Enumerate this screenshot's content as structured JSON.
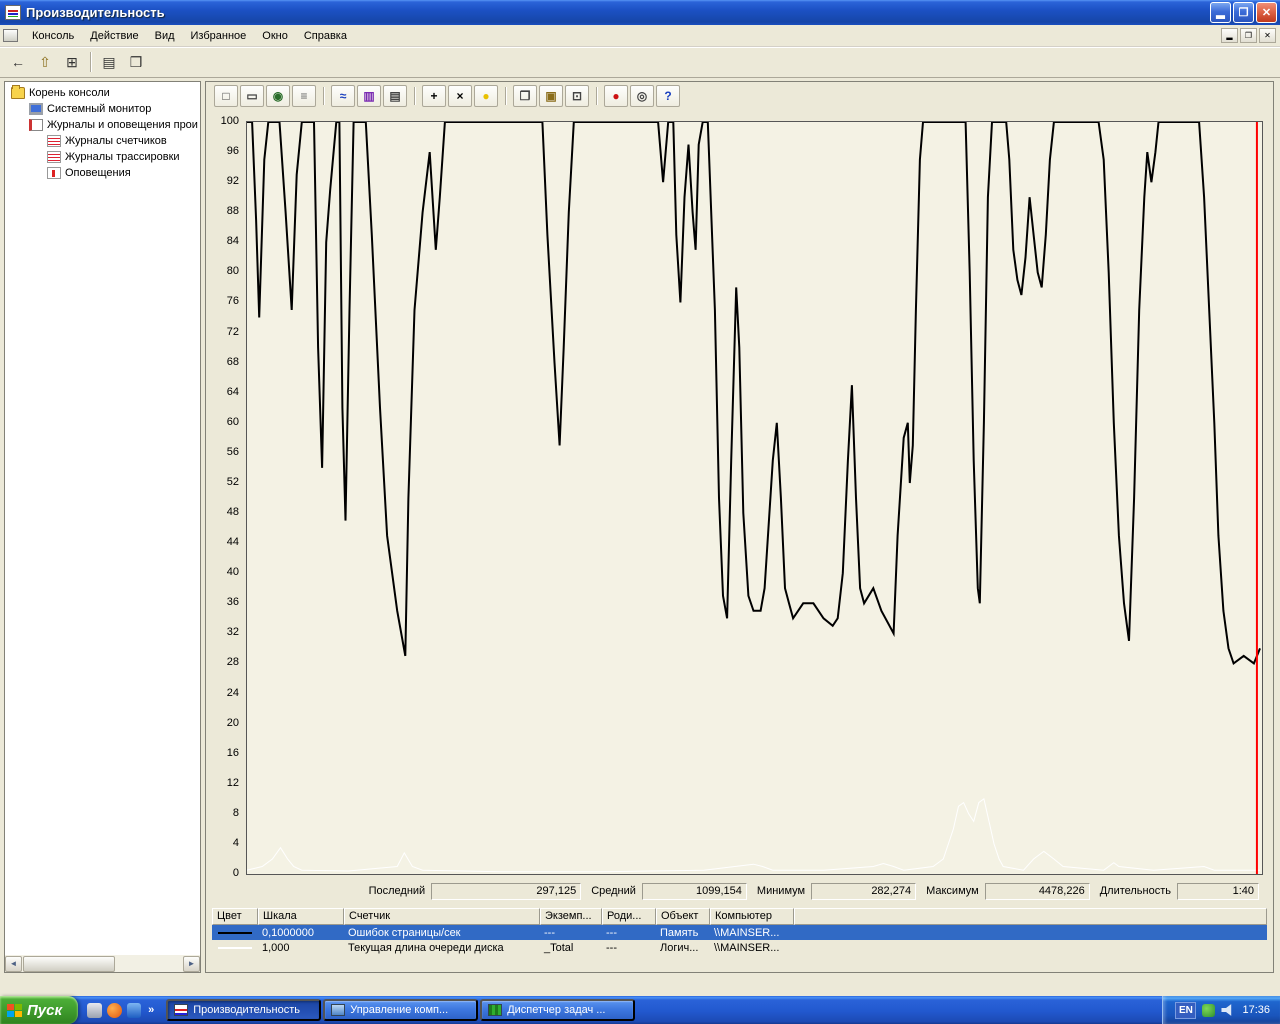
{
  "window": {
    "title": "Производительность",
    "controls": {
      "minimize": "▂",
      "restore": "❐",
      "close": "✕"
    }
  },
  "menubar": {
    "items": [
      "Консоль",
      "Действие",
      "Вид",
      "Избранное",
      "Окно",
      "Справка"
    ]
  },
  "main_toolbar": {
    "buttons": [
      {
        "name": "back-button",
        "glyph": "←",
        "color": "#333333"
      },
      {
        "name": "up-one-level-button",
        "glyph": "⇧",
        "color": "#8a6d1a"
      },
      {
        "name": "show-hide-console-tree-button",
        "glyph": "⊞",
        "color": "#333333"
      },
      {
        "name": "export-list-button",
        "glyph": "▤",
        "color": "#333333",
        "sep_before": true
      },
      {
        "name": "help-topics-button",
        "glyph": "❒",
        "color": "#333333"
      }
    ]
  },
  "tree": {
    "items": [
      {
        "id": "console-root",
        "label": "Корень консоли",
        "icon": "folder",
        "indent": 0
      },
      {
        "id": "system-monitor",
        "label": "Системный монитор",
        "icon": "monitor",
        "indent": 1
      },
      {
        "id": "logs-and-alerts",
        "label": "Журналы и оповещения прои",
        "icon": "logs",
        "indent": 1
      },
      {
        "id": "counter-logs",
        "label": "Журналы счетчиков",
        "icon": "redlog",
        "indent": 2
      },
      {
        "id": "trace-logs",
        "label": "Журналы трассировки",
        "icon": "redlog",
        "indent": 2
      },
      {
        "id": "alerts",
        "label": "Оповещения",
        "icon": "alert",
        "indent": 2
      }
    ]
  },
  "perfmon_toolbar": {
    "buttons": [
      {
        "name": "new-counter-set-button",
        "glyph": "□",
        "color": "#444444"
      },
      {
        "name": "clear-display-button",
        "glyph": "▭",
        "color": "#444444"
      },
      {
        "name": "view-current-activity-button",
        "glyph": "◉",
        "color": "#2a6d2a"
      },
      {
        "name": "view-log-data-button",
        "glyph": "≡",
        "color": "#666666"
      },
      {
        "name": "view-graph-button",
        "glyph": "≈",
        "color": "#1a3fbf",
        "sep_before": true
      },
      {
        "name": "view-histogram-button",
        "glyph": "▥",
        "color": "#7a2bb2"
      },
      {
        "name": "view-report-button",
        "glyph": "▤",
        "color": "#444444"
      },
      {
        "name": "add-counter-button",
        "glyph": "+",
        "color": "#000000",
        "sep_before": true
      },
      {
        "name": "delete-counter-button",
        "glyph": "×",
        "color": "#000000"
      },
      {
        "name": "highlight-button",
        "glyph": "●",
        "color": "#e8c000"
      },
      {
        "name": "copy-properties-button",
        "glyph": "❐",
        "color": "#444444",
        "sep_before": true
      },
      {
        "name": "paste-counter-list-button",
        "glyph": "▣",
        "color": "#8a6d1a"
      },
      {
        "name": "properties-button",
        "glyph": "⊡",
        "color": "#444444"
      },
      {
        "name": "freeze-display-button",
        "glyph": "●",
        "color": "#cc1111",
        "sep_before": true
      },
      {
        "name": "update-data-button",
        "glyph": "◎",
        "color": "#444444"
      },
      {
        "name": "help-button",
        "glyph": "?",
        "color": "#1a3fbf"
      }
    ]
  },
  "stats": [
    {
      "label": "Последний",
      "value": "297,125"
    },
    {
      "label": "Средний",
      "value": "1099,154"
    },
    {
      "label": "Минимум",
      "value": "282,274"
    },
    {
      "label": "Максимум",
      "value": "4478,226"
    },
    {
      "label": "Длительность",
      "value": "1:40"
    }
  ],
  "legend": {
    "headers": [
      "Цвет",
      "Шкала",
      "Счетчик",
      "Экземп...",
      "Роди...",
      "Объект",
      "Компьютер"
    ],
    "rows": [
      {
        "selected": true,
        "color": "#000000",
        "scale": "0,1000000",
        "counter": "Ошибок страницы/сек",
        "instance": "---",
        "parent": "---",
        "object": "Память",
        "computer": "\\\\MAINSER..."
      },
      {
        "selected": false,
        "color": "#ffffff",
        "scale": "1,000",
        "counter": "Текущая длина очереди диска",
        "instance": "_Total",
        "parent": "---",
        "object": "Логич...",
        "computer": "\\\\MAINSER..."
      }
    ]
  },
  "taskbar": {
    "start_label": "Пуск",
    "quick_launch_chevron": "»",
    "tasks": [
      {
        "id": "performance",
        "label": "Производительность",
        "icon": "perfmon",
        "active": true
      },
      {
        "id": "computer-management",
        "label": "Управление комп...",
        "icon": "computer",
        "active": false
      },
      {
        "id": "task-manager",
        "label": "Диспетчер задач ...",
        "icon": "taskman",
        "active": false
      }
    ],
    "tray": {
      "language_indicator": "EN",
      "clock": "17:36"
    }
  },
  "chart_data": {
    "type": "line",
    "title": "",
    "xlabel": "",
    "ylabel": "",
    "ylim": [
      0,
      100
    ],
    "grid": false,
    "legend_position": "bottom-table",
    "y_ticks": [
      100,
      96,
      92,
      88,
      84,
      80,
      76,
      72,
      68,
      64,
      60,
      56,
      52,
      48,
      44,
      40,
      36,
      32,
      28,
      24,
      20,
      16,
      12,
      8,
      4,
      0
    ],
    "duration": "1:40",
    "timeline": {
      "x_pct": 99.5,
      "color": "#ff0000"
    },
    "stats": {
      "last": "297,125",
      "average": "1099,154",
      "minimum": "282,274",
      "maximum": "4478,226",
      "duration": "1:40"
    },
    "series": [
      {
        "name": "Ошибок страницы/сек (шкала 0,1)",
        "color": "#000000",
        "width": 2,
        "points": [
          [
            0,
            100
          ],
          [
            0.5,
            100
          ],
          [
            0.9,
            87
          ],
          [
            1.2,
            74
          ],
          [
            1.7,
            95
          ],
          [
            2.1,
            100
          ],
          [
            3.2,
            100
          ],
          [
            3.8,
            88
          ],
          [
            4.4,
            75
          ],
          [
            4.9,
            93
          ],
          [
            5.4,
            100
          ],
          [
            6.6,
            100
          ],
          [
            7.0,
            70
          ],
          [
            7.4,
            54
          ],
          [
            7.8,
            84
          ],
          [
            8.2,
            91
          ],
          [
            8.8,
            100
          ],
          [
            9.1,
            100
          ],
          [
            9.4,
            62
          ],
          [
            9.7,
            47
          ],
          [
            10.1,
            75
          ],
          [
            10.5,
            100
          ],
          [
            11.7,
            100
          ],
          [
            12.3,
            85
          ],
          [
            13.1,
            62
          ],
          [
            13.8,
            45
          ],
          [
            14.8,
            35
          ],
          [
            15.6,
            29
          ],
          [
            15.9,
            50
          ],
          [
            16.5,
            75
          ],
          [
            17.3,
            88
          ],
          [
            18.0,
            96
          ],
          [
            18.6,
            83
          ],
          [
            19.0,
            90
          ],
          [
            19.5,
            100
          ],
          [
            29.1,
            100
          ],
          [
            29.6,
            85
          ],
          [
            30.3,
            68
          ],
          [
            30.8,
            57
          ],
          [
            31.2,
            70
          ],
          [
            31.7,
            88
          ],
          [
            32.2,
            100
          ],
          [
            40.5,
            100
          ],
          [
            41.0,
            92
          ],
          [
            41.5,
            100
          ],
          [
            42.0,
            100
          ],
          [
            42.3,
            85
          ],
          [
            42.7,
            76
          ],
          [
            43.1,
            90
          ],
          [
            43.5,
            97
          ],
          [
            43.9,
            88
          ],
          [
            44.2,
            83
          ],
          [
            44.5,
            97
          ],
          [
            44.9,
            100
          ],
          [
            45.4,
            100
          ],
          [
            46.1,
            75
          ],
          [
            46.5,
            50
          ],
          [
            46.9,
            37
          ],
          [
            47.3,
            34
          ],
          [
            47.7,
            55
          ],
          [
            48.2,
            78
          ],
          [
            48.5,
            70
          ],
          [
            48.9,
            48
          ],
          [
            49.4,
            37
          ],
          [
            49.9,
            35
          ],
          [
            50.6,
            35
          ],
          [
            51.0,
            38
          ],
          [
            51.8,
            55
          ],
          [
            52.2,
            60
          ],
          [
            52.6,
            50
          ],
          [
            53.0,
            38
          ],
          [
            53.4,
            36
          ],
          [
            53.8,
            34
          ],
          [
            54.8,
            36
          ],
          [
            55.8,
            36
          ],
          [
            56.8,
            34
          ],
          [
            57.7,
            33
          ],
          [
            58.2,
            34
          ],
          [
            58.7,
            40
          ],
          [
            59.2,
            55
          ],
          [
            59.6,
            65
          ],
          [
            60.0,
            50
          ],
          [
            60.4,
            38
          ],
          [
            60.8,
            36
          ],
          [
            61.7,
            38
          ],
          [
            62.5,
            35
          ],
          [
            63.3,
            33
          ],
          [
            63.7,
            32
          ],
          [
            64.1,
            45
          ],
          [
            64.7,
            58
          ],
          [
            65.1,
            60
          ],
          [
            65.3,
            52
          ],
          [
            65.6,
            57
          ],
          [
            65.9,
            75
          ],
          [
            66.3,
            95
          ],
          [
            66.6,
            100
          ],
          [
            70.8,
            100
          ],
          [
            71.2,
            80
          ],
          [
            71.6,
            55
          ],
          [
            72.0,
            38
          ],
          [
            72.2,
            36
          ],
          [
            72.6,
            60
          ],
          [
            73.0,
            90
          ],
          [
            73.4,
            100
          ],
          [
            74.8,
            100
          ],
          [
            75.1,
            95
          ],
          [
            75.5,
            83
          ],
          [
            75.9,
            79
          ],
          [
            76.3,
            77
          ],
          [
            76.7,
            82
          ],
          [
            77.1,
            90
          ],
          [
            77.5,
            85
          ],
          [
            77.9,
            80
          ],
          [
            78.3,
            78
          ],
          [
            78.7,
            85
          ],
          [
            79.1,
            95
          ],
          [
            79.5,
            100
          ],
          [
            83.9,
            100
          ],
          [
            84.4,
            95
          ],
          [
            84.9,
            80
          ],
          [
            85.4,
            60
          ],
          [
            85.9,
            45
          ],
          [
            86.4,
            36
          ],
          [
            86.9,
            31
          ],
          [
            87.4,
            50
          ],
          [
            87.9,
            75
          ],
          [
            88.4,
            90
          ],
          [
            88.7,
            96
          ],
          [
            89.1,
            92
          ],
          [
            89.5,
            96
          ],
          [
            89.8,
            100
          ],
          [
            90.3,
            100
          ],
          [
            93.8,
            100
          ],
          [
            94.3,
            90
          ],
          [
            94.8,
            75
          ],
          [
            95.3,
            60
          ],
          [
            95.7,
            45
          ],
          [
            96.2,
            35
          ],
          [
            96.7,
            30
          ],
          [
            97.2,
            28
          ],
          [
            98.2,
            29
          ],
          [
            99.2,
            28
          ],
          [
            99.8,
            30
          ]
        ]
      },
      {
        "name": "Текущая длина очереди диска (_Total)",
        "color": "#ffffff",
        "width": 1,
        "points": [
          [
            0,
            0.5
          ],
          [
            1.5,
            1
          ],
          [
            2.5,
            2
          ],
          [
            3.3,
            3.5
          ],
          [
            4.0,
            2
          ],
          [
            4.6,
            1
          ],
          [
            5.4,
            0.5
          ],
          [
            10,
            0.4
          ],
          [
            14.8,
            1
          ],
          [
            15.5,
            2.8
          ],
          [
            16.3,
            1
          ],
          [
            17.3,
            0.5
          ],
          [
            25,
            0.3
          ],
          [
            35,
            0.3
          ],
          [
            45,
            0.5
          ],
          [
            49.9,
            1.3
          ],
          [
            50.8,
            1
          ],
          [
            51.8,
            0.5
          ],
          [
            56.8,
            0.5
          ],
          [
            61.7,
            1
          ],
          [
            62.7,
            1.4
          ],
          [
            63.7,
            1
          ],
          [
            64.7,
            0.5
          ],
          [
            67.6,
            1
          ],
          [
            68.6,
            2
          ],
          [
            69.6,
            6
          ],
          [
            70.1,
            9
          ],
          [
            70.6,
            9.5
          ],
          [
            71.1,
            8
          ],
          [
            71.6,
            7
          ],
          [
            72.1,
            9.5
          ],
          [
            72.6,
            10
          ],
          [
            73.1,
            7
          ],
          [
            73.6,
            4
          ],
          [
            74.1,
            2
          ],
          [
            74.5,
            1
          ],
          [
            76.5,
            0.5
          ],
          [
            77.5,
            2
          ],
          [
            78.5,
            3
          ],
          [
            79.5,
            2
          ],
          [
            80.4,
            1
          ],
          [
            84.4,
            0.5
          ],
          [
            85.4,
            1.5
          ],
          [
            85.9,
            1
          ],
          [
            89.3,
            0.5
          ],
          [
            94.3,
            1
          ],
          [
            95.3,
            0.5
          ],
          [
            99.8,
            0.5
          ]
        ]
      }
    ]
  }
}
